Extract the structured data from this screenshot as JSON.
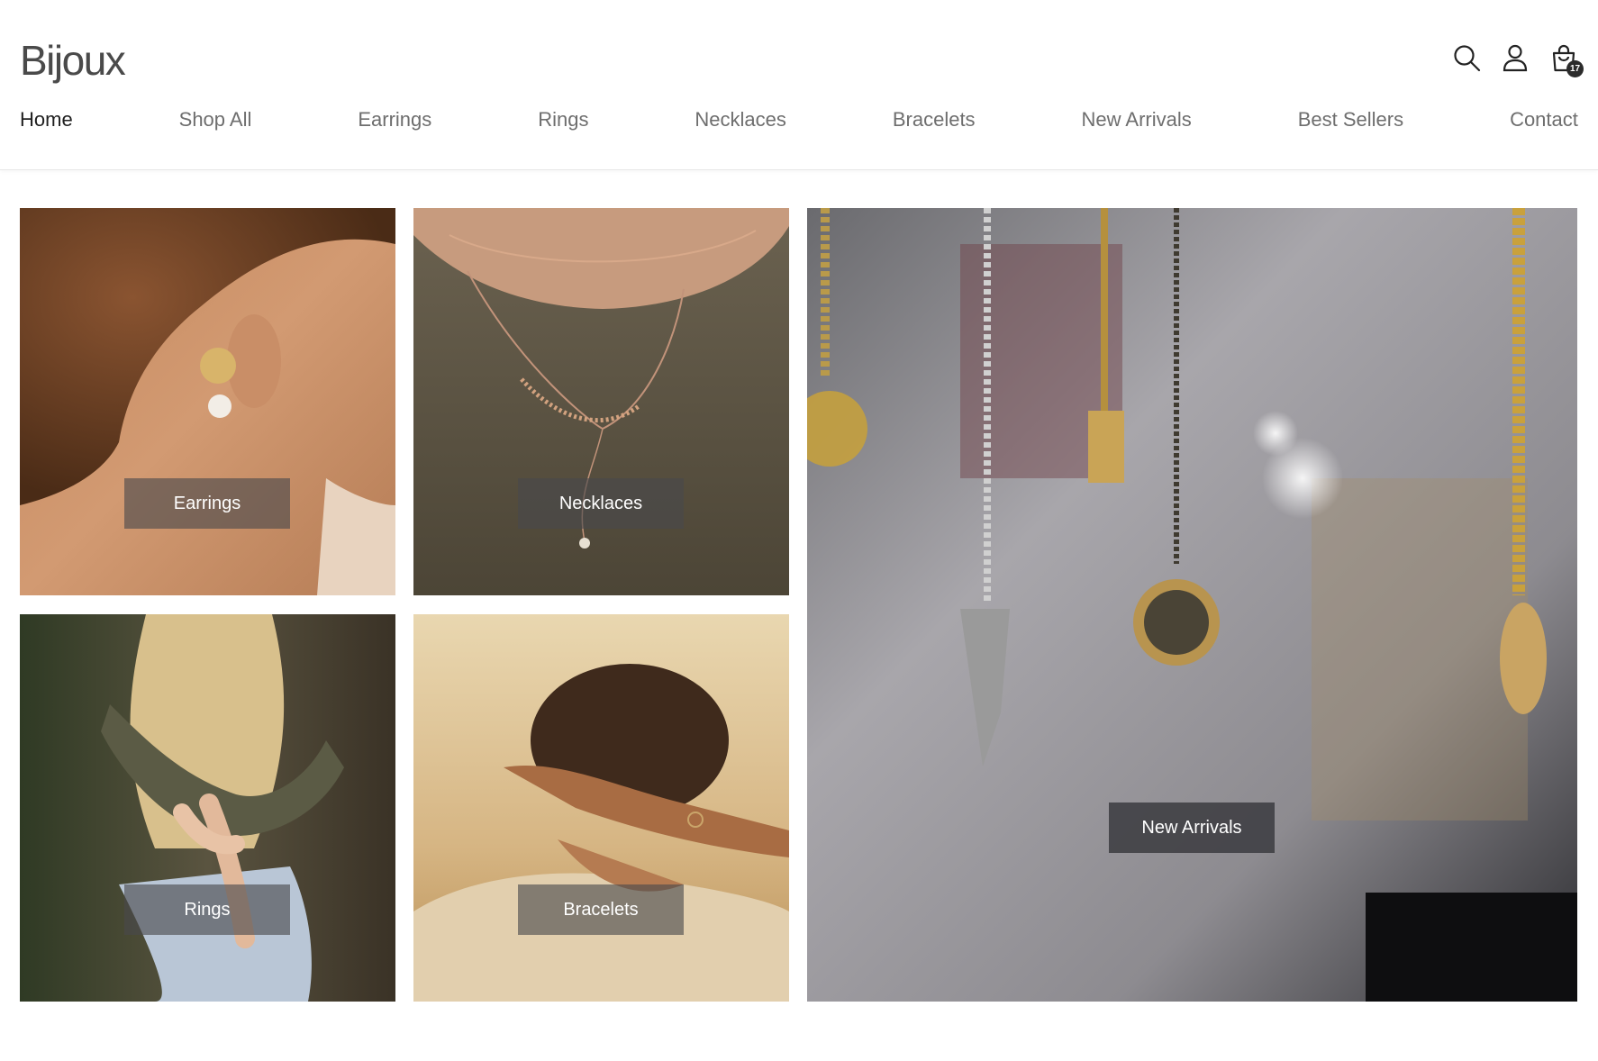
{
  "brand": {
    "name": "Bijoux"
  },
  "header_icons": [
    {
      "name": "search-icon"
    },
    {
      "name": "user-icon"
    },
    {
      "name": "shopping-bag-icon"
    }
  ],
  "cart": {
    "count": "17"
  },
  "nav": {
    "items": [
      {
        "label": "Home",
        "active": true
      },
      {
        "label": "Shop All"
      },
      {
        "label": "Earrings"
      },
      {
        "label": "Rings"
      },
      {
        "label": "Necklaces"
      },
      {
        "label": "Bracelets"
      },
      {
        "label": "New Arrivals"
      },
      {
        "label": "Best Sellers"
      },
      {
        "label": "Contact"
      }
    ]
  },
  "categories": {
    "earrings": "Earrings",
    "necklaces": "Necklaces",
    "rings": "Rings",
    "bracelets": "Bracelets",
    "new_arrivals": "New Arrivals"
  },
  "colors": {
    "text": "#333333",
    "label_bg": "#48484c",
    "badge": "#2b2b2b"
  }
}
